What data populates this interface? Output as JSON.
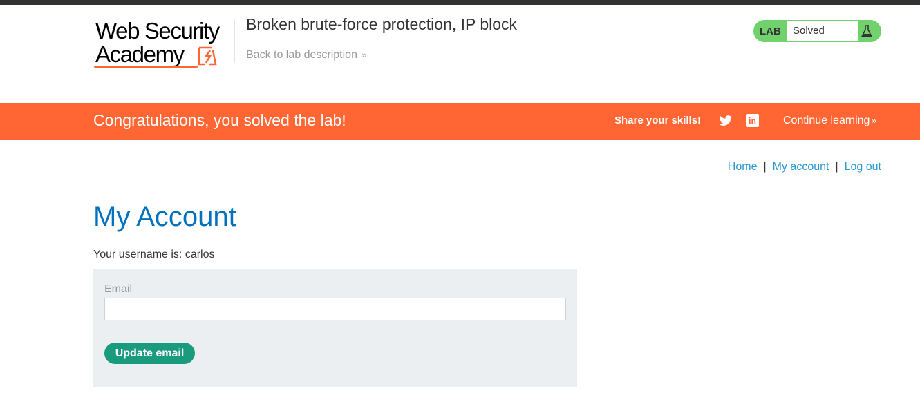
{
  "header": {
    "logo_line1": "Web Security",
    "logo_line2": "Academy",
    "lab_title": "Broken brute-force protection, IP block",
    "back_link": "Back to lab description",
    "back_chevron": "»",
    "lab_status": {
      "label": "LAB",
      "value": "Solved"
    }
  },
  "banner": {
    "message": "Congratulations, you solved the lab!",
    "share_text": "Share your skills!",
    "continue_label": "Continue learning",
    "continue_chevron": "»",
    "background_color": "#ff6633"
  },
  "nav": {
    "home": "Home",
    "separator1": "|",
    "my_account": "My account",
    "separator2": "|",
    "logout": "Log out"
  },
  "main": {
    "title": "My Account",
    "username_text": "Your username is: carlos",
    "email_label": "Email",
    "email_value": "",
    "update_button": "Update email"
  },
  "colors": {
    "accent_orange": "#ff6633",
    "link_blue": "#2a9ad0",
    "title_blue": "#0071bc",
    "button_green": "#1a9b7d",
    "status_green": "#70d16d"
  }
}
